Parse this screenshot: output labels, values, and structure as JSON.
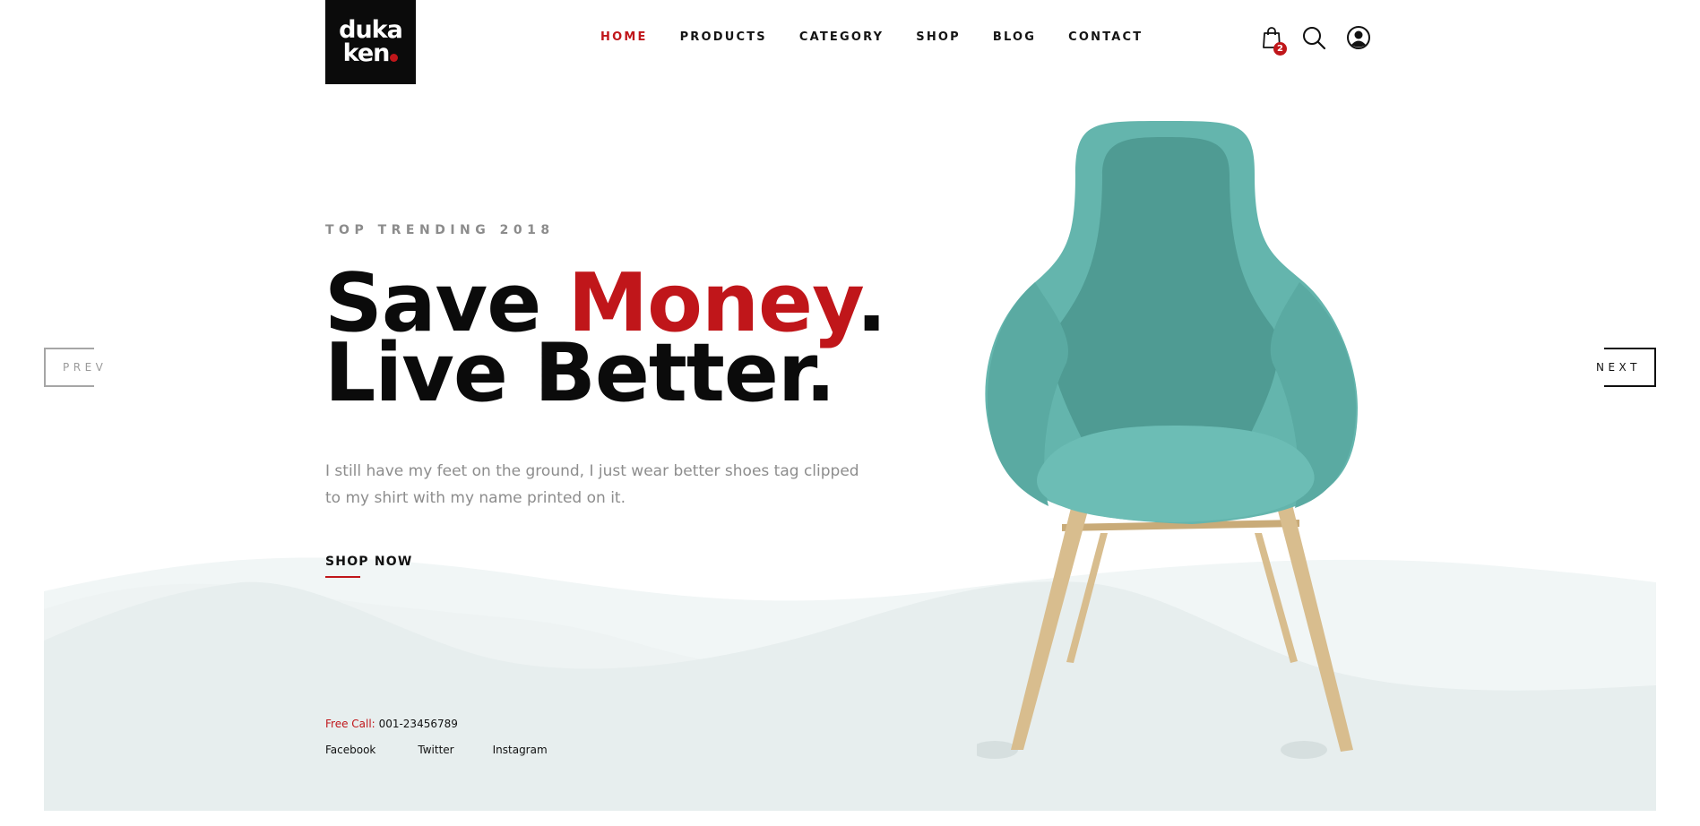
{
  "brand": {
    "logo_line1": "duka",
    "logo_line2": "ken",
    "accent_color": "#c0161a"
  },
  "nav": {
    "items": [
      {
        "label": "HOME",
        "active": true
      },
      {
        "label": "PRODUCTS",
        "active": false
      },
      {
        "label": "CATEGORY",
        "active": false
      },
      {
        "label": "SHOP",
        "active": false
      },
      {
        "label": "BLOG",
        "active": false
      },
      {
        "label": "CONTACT",
        "active": false
      }
    ]
  },
  "header_icons": {
    "cart_icon": "shopping-bag-icon",
    "cart_count": "2",
    "search_icon": "search-icon",
    "account_icon": "user-icon"
  },
  "hero": {
    "eyebrow": "TOP TRENDING 2018",
    "headline_part1": "Save ",
    "headline_accent": "Money",
    "headline_part2": ".",
    "headline_line2": "Live Better.",
    "description": "I still have my feet on the ground, I just wear better shoes tag clipped to my shirt with my name printed on it.",
    "cta": "SHOP NOW"
  },
  "slider": {
    "prev_label": "PREV",
    "next_label": "NEXT"
  },
  "footer_info": {
    "call_label": "Free Call:",
    "phone": "001-23456789",
    "socials": [
      "Facebook",
      "Twitter",
      "Instagram"
    ]
  },
  "colors": {
    "wave_light": "#f1f6f6",
    "wave_dark": "#e7eeee",
    "chair_fabric": "#64b5ad",
    "chair_legs": "#d8bd8e"
  }
}
